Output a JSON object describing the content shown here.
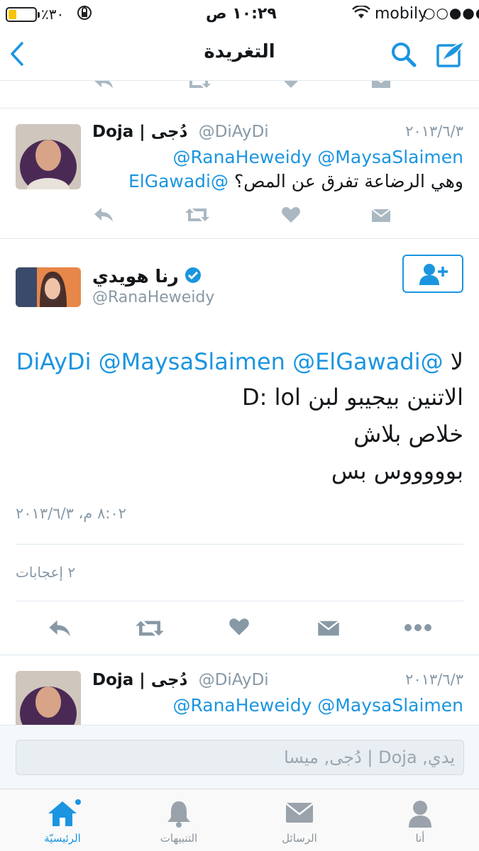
{
  "status_bar": {
    "carrier": "mobily",
    "signal_dots": "○○●●●",
    "time": "١٠:٢٩ ص",
    "battery": "٪٣٠",
    "battery_level": 0.3
  },
  "nav": {
    "title": "التغريدة"
  },
  "top_tweet": {
    "name": "Doja | دُجى",
    "handle": "@DiAyDi",
    "date": "٢٠١٣/٦/٣",
    "line1": "@RanaHeweidy @MaysaSlaimen",
    "line2_mention": "@ElGawadi",
    "line2_text": "وهي الرضاعة تفرق عن المص؟"
  },
  "main_tweet": {
    "name": "رنا هويدي",
    "handle": "@RanaHeweidy",
    "line1_mentions": "@DiAyDi @MaysaSlaimen @ElGawadi",
    "line1_word": "لا",
    "line2": "الاتنين بيجيبو لبن D: lol",
    "line3": "خلاص بلاش",
    "line4": "بوووووس بس",
    "timestamp": "٨:٠٢ م، ٢٠١٣/٦/٣",
    "likes_label": "٢ إعجابات"
  },
  "bottom_tweet": {
    "name": "Doja | دُجى",
    "handle": "@DiAyDi",
    "date": "٢٠١٣/٦/٣",
    "line1": "@RanaHeweidy @MaysaSlaimen"
  },
  "composer": {
    "placeholder": "يدي, Doja | دُجى, ميسا"
  },
  "tabs": [
    {
      "label": "الرئيسيّة"
    },
    {
      "label": "التنبيهات"
    },
    {
      "label": "الرسائل"
    },
    {
      "label": "أنا"
    }
  ],
  "colors": {
    "accent": "#1b95e0",
    "muted": "#8899a6"
  }
}
